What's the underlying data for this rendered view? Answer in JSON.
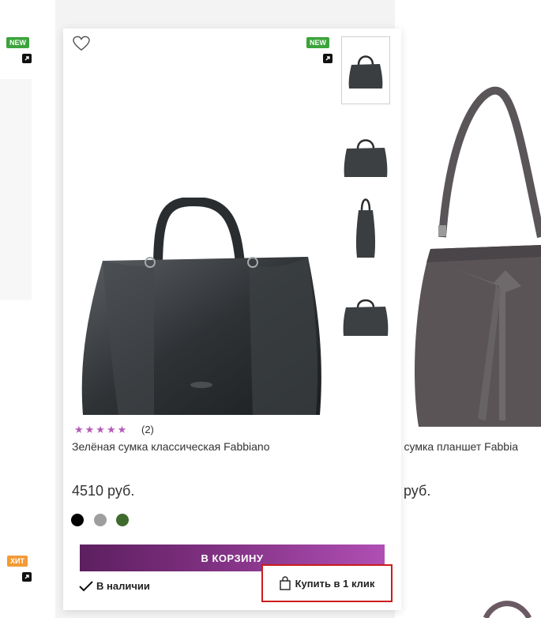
{
  "left_product": {
    "badge_top": "NEW",
    "badge_bottom": "ХИТ"
  },
  "main_product": {
    "badge": "NEW",
    "stars": "★★★★★",
    "rating_count": "(2)",
    "title": "Зелёная сумка классическая Fabbiano",
    "price": "4510 руб.",
    "colors": [
      "#000000",
      "#9e9e9e",
      "#3f6b2e"
    ],
    "cart_button": "В КОРЗИНУ",
    "stock_label": "В наличии",
    "one_click_label": "Купить в 1 клик",
    "accent_color": "#7c2f7e",
    "highlight_color": "#cc1c1c"
  },
  "right_product": {
    "title_partial": "я сумка планшет Fabbia",
    "price_partial": ") руб."
  }
}
